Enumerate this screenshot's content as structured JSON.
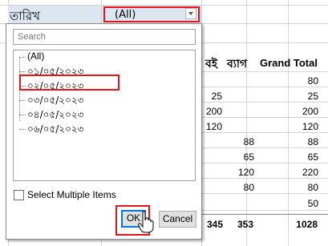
{
  "filter": {
    "label": "তারিখ",
    "value": "(All)"
  },
  "columns": {
    "col1": "বই",
    "col2": "ব্যাগ",
    "total": "Grand Total"
  },
  "rows": [
    {
      "c1": "",
      "c2": "",
      "total": "80"
    },
    {
      "c1": "25",
      "c2": "",
      "total": "25"
    },
    {
      "c1": "200",
      "c2": "",
      "total": "200"
    },
    {
      "c1": "120",
      "c2": "",
      "total": "120"
    },
    {
      "c1": "",
      "c2": "88",
      "total": "88"
    },
    {
      "c1": "",
      "c2": "65",
      "total": "65"
    },
    {
      "c1": "",
      "c2": "120",
      "total": "220"
    },
    {
      "c1": "",
      "c2": "80",
      "total": "80"
    },
    {
      "c1": "",
      "c2": "",
      "total": "50"
    }
  ],
  "grand_total": {
    "c1": "345",
    "c2": "353",
    "total": "1028"
  },
  "panel": {
    "search_placeholder": "Search",
    "items": [
      "(All)",
      "০১/০৫/২০২৩",
      "০২/০৫/২০২৩",
      "০৩/০৫/২০২৩",
      "০৪/০৫/২০২৩",
      "০৬/০৫/২০২৩"
    ],
    "multi_label": "Select Multiple Items",
    "ok_label": "OK",
    "cancel_label": "Cancel"
  },
  "colors": {
    "highlight": "#e8141c",
    "filter_fill": "#dce6f1"
  }
}
